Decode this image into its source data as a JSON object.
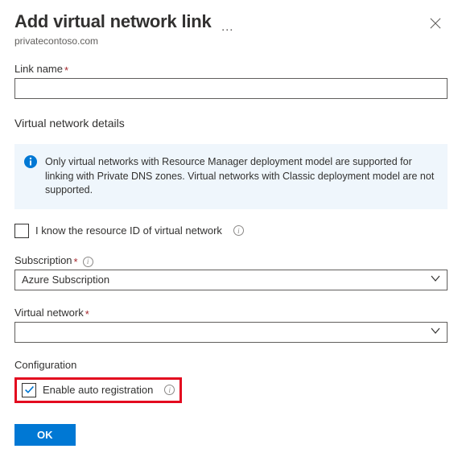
{
  "header": {
    "title": "Add virtual network link",
    "subtitle": "privatecontoso.com"
  },
  "linkName": {
    "label": "Link name",
    "value": ""
  },
  "detailsSection": {
    "title": "Virtual network details",
    "infoText": "Only virtual networks with Resource Manager deployment model are supported for linking with Private DNS zones. Virtual networks with Classic deployment model are not supported."
  },
  "resourceIdCheckbox": {
    "label": "I know the resource ID of virtual network",
    "checked": false
  },
  "subscription": {
    "label": "Subscription",
    "selected": "Azure Subscription"
  },
  "virtualNetwork": {
    "label": "Virtual network",
    "selected": ""
  },
  "configSection": {
    "title": "Configuration"
  },
  "autoReg": {
    "label": "Enable auto registration",
    "checked": true
  },
  "okButton": {
    "label": "OK"
  }
}
